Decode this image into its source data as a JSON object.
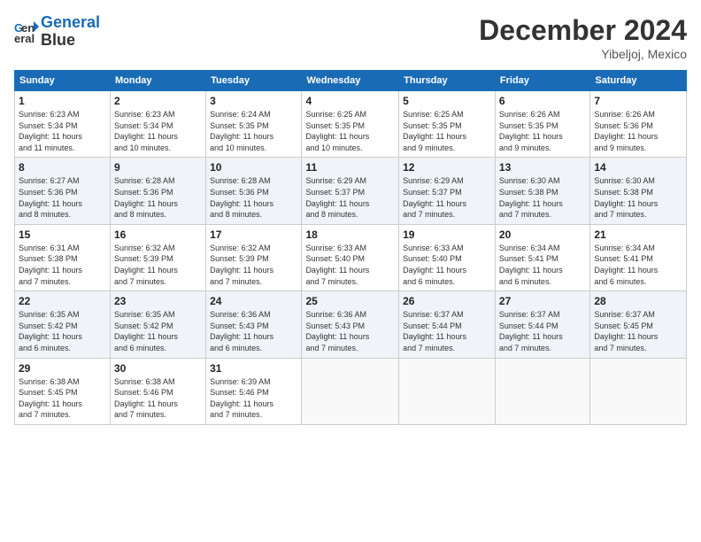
{
  "header": {
    "logo_line1": "General",
    "logo_line2": "Blue",
    "month": "December 2024",
    "location": "Yibeljoj, Mexico"
  },
  "weekdays": [
    "Sunday",
    "Monday",
    "Tuesday",
    "Wednesday",
    "Thursday",
    "Friday",
    "Saturday"
  ],
  "weeks": [
    [
      {
        "day": "1",
        "info": "Sunrise: 6:23 AM\nSunset: 5:34 PM\nDaylight: 11 hours\nand 11 minutes."
      },
      {
        "day": "2",
        "info": "Sunrise: 6:23 AM\nSunset: 5:34 PM\nDaylight: 11 hours\nand 10 minutes."
      },
      {
        "day": "3",
        "info": "Sunrise: 6:24 AM\nSunset: 5:35 PM\nDaylight: 11 hours\nand 10 minutes."
      },
      {
        "day": "4",
        "info": "Sunrise: 6:25 AM\nSunset: 5:35 PM\nDaylight: 11 hours\nand 10 minutes."
      },
      {
        "day": "5",
        "info": "Sunrise: 6:25 AM\nSunset: 5:35 PM\nDaylight: 11 hours\nand 9 minutes."
      },
      {
        "day": "6",
        "info": "Sunrise: 6:26 AM\nSunset: 5:35 PM\nDaylight: 11 hours\nand 9 minutes."
      },
      {
        "day": "7",
        "info": "Sunrise: 6:26 AM\nSunset: 5:36 PM\nDaylight: 11 hours\nand 9 minutes."
      }
    ],
    [
      {
        "day": "8",
        "info": "Sunrise: 6:27 AM\nSunset: 5:36 PM\nDaylight: 11 hours\nand 8 minutes."
      },
      {
        "day": "9",
        "info": "Sunrise: 6:28 AM\nSunset: 5:36 PM\nDaylight: 11 hours\nand 8 minutes."
      },
      {
        "day": "10",
        "info": "Sunrise: 6:28 AM\nSunset: 5:36 PM\nDaylight: 11 hours\nand 8 minutes."
      },
      {
        "day": "11",
        "info": "Sunrise: 6:29 AM\nSunset: 5:37 PM\nDaylight: 11 hours\nand 8 minutes."
      },
      {
        "day": "12",
        "info": "Sunrise: 6:29 AM\nSunset: 5:37 PM\nDaylight: 11 hours\nand 7 minutes."
      },
      {
        "day": "13",
        "info": "Sunrise: 6:30 AM\nSunset: 5:38 PM\nDaylight: 11 hours\nand 7 minutes."
      },
      {
        "day": "14",
        "info": "Sunrise: 6:30 AM\nSunset: 5:38 PM\nDaylight: 11 hours\nand 7 minutes."
      }
    ],
    [
      {
        "day": "15",
        "info": "Sunrise: 6:31 AM\nSunset: 5:38 PM\nDaylight: 11 hours\nand 7 minutes."
      },
      {
        "day": "16",
        "info": "Sunrise: 6:32 AM\nSunset: 5:39 PM\nDaylight: 11 hours\nand 7 minutes."
      },
      {
        "day": "17",
        "info": "Sunrise: 6:32 AM\nSunset: 5:39 PM\nDaylight: 11 hours\nand 7 minutes."
      },
      {
        "day": "18",
        "info": "Sunrise: 6:33 AM\nSunset: 5:40 PM\nDaylight: 11 hours\nand 7 minutes."
      },
      {
        "day": "19",
        "info": "Sunrise: 6:33 AM\nSunset: 5:40 PM\nDaylight: 11 hours\nand 6 minutes."
      },
      {
        "day": "20",
        "info": "Sunrise: 6:34 AM\nSunset: 5:41 PM\nDaylight: 11 hours\nand 6 minutes."
      },
      {
        "day": "21",
        "info": "Sunrise: 6:34 AM\nSunset: 5:41 PM\nDaylight: 11 hours\nand 6 minutes."
      }
    ],
    [
      {
        "day": "22",
        "info": "Sunrise: 6:35 AM\nSunset: 5:42 PM\nDaylight: 11 hours\nand 6 minutes."
      },
      {
        "day": "23",
        "info": "Sunrise: 6:35 AM\nSunset: 5:42 PM\nDaylight: 11 hours\nand 6 minutes."
      },
      {
        "day": "24",
        "info": "Sunrise: 6:36 AM\nSunset: 5:43 PM\nDaylight: 11 hours\nand 6 minutes."
      },
      {
        "day": "25",
        "info": "Sunrise: 6:36 AM\nSunset: 5:43 PM\nDaylight: 11 hours\nand 7 minutes."
      },
      {
        "day": "26",
        "info": "Sunrise: 6:37 AM\nSunset: 5:44 PM\nDaylight: 11 hours\nand 7 minutes."
      },
      {
        "day": "27",
        "info": "Sunrise: 6:37 AM\nSunset: 5:44 PM\nDaylight: 11 hours\nand 7 minutes."
      },
      {
        "day": "28",
        "info": "Sunrise: 6:37 AM\nSunset: 5:45 PM\nDaylight: 11 hours\nand 7 minutes."
      }
    ],
    [
      {
        "day": "29",
        "info": "Sunrise: 6:38 AM\nSunset: 5:45 PM\nDaylight: 11 hours\nand 7 minutes."
      },
      {
        "day": "30",
        "info": "Sunrise: 6:38 AM\nSunset: 5:46 PM\nDaylight: 11 hours\nand 7 minutes."
      },
      {
        "day": "31",
        "info": "Sunrise: 6:39 AM\nSunset: 5:46 PM\nDaylight: 11 hours\nand 7 minutes."
      },
      {
        "day": "",
        "info": ""
      },
      {
        "day": "",
        "info": ""
      },
      {
        "day": "",
        "info": ""
      },
      {
        "day": "",
        "info": ""
      }
    ]
  ]
}
